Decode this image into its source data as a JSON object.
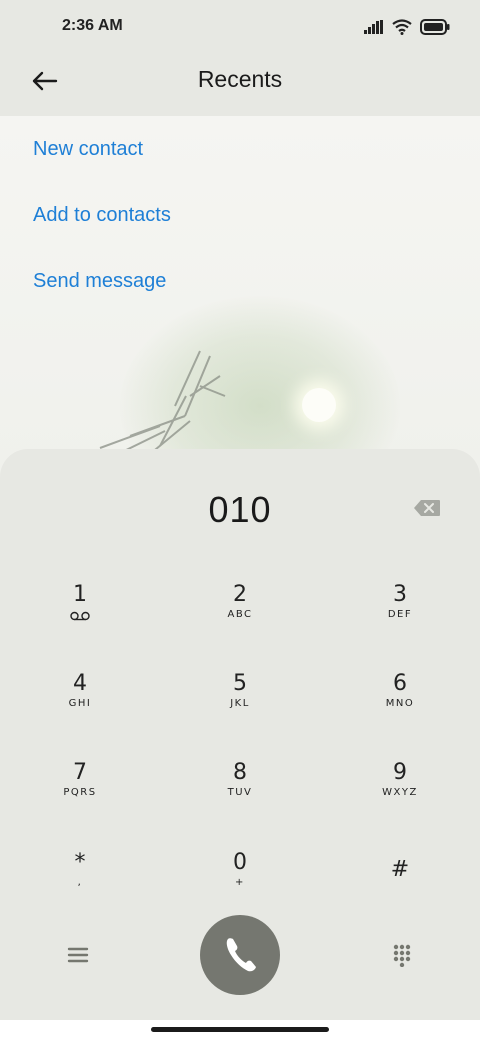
{
  "status_bar": {
    "time": "2:36 AM"
  },
  "header": {
    "title": "Recents"
  },
  "actions": [
    {
      "label": "New contact"
    },
    {
      "label": "Add to contacts"
    },
    {
      "label": "Send message"
    }
  ],
  "dialer": {
    "number": "010",
    "keys": [
      {
        "digit": "1",
        "letters": ""
      },
      {
        "digit": "2",
        "letters": "ABC"
      },
      {
        "digit": "3",
        "letters": "DEF"
      },
      {
        "digit": "4",
        "letters": "GHI"
      },
      {
        "digit": "5",
        "letters": "JKL"
      },
      {
        "digit": "6",
        "letters": "MNO"
      },
      {
        "digit": "7",
        "letters": "PQRS"
      },
      {
        "digit": "8",
        "letters": "TUV"
      },
      {
        "digit": "9",
        "letters": "WXYZ"
      },
      {
        "digit": "*",
        "letters": ","
      },
      {
        "digit": "0",
        "letters": "+"
      },
      {
        "digit": "#",
        "letters": ""
      }
    ]
  },
  "colors": {
    "accent": "#1e7fd6",
    "panel": "#e7e8e3",
    "call_button": "#757770"
  }
}
